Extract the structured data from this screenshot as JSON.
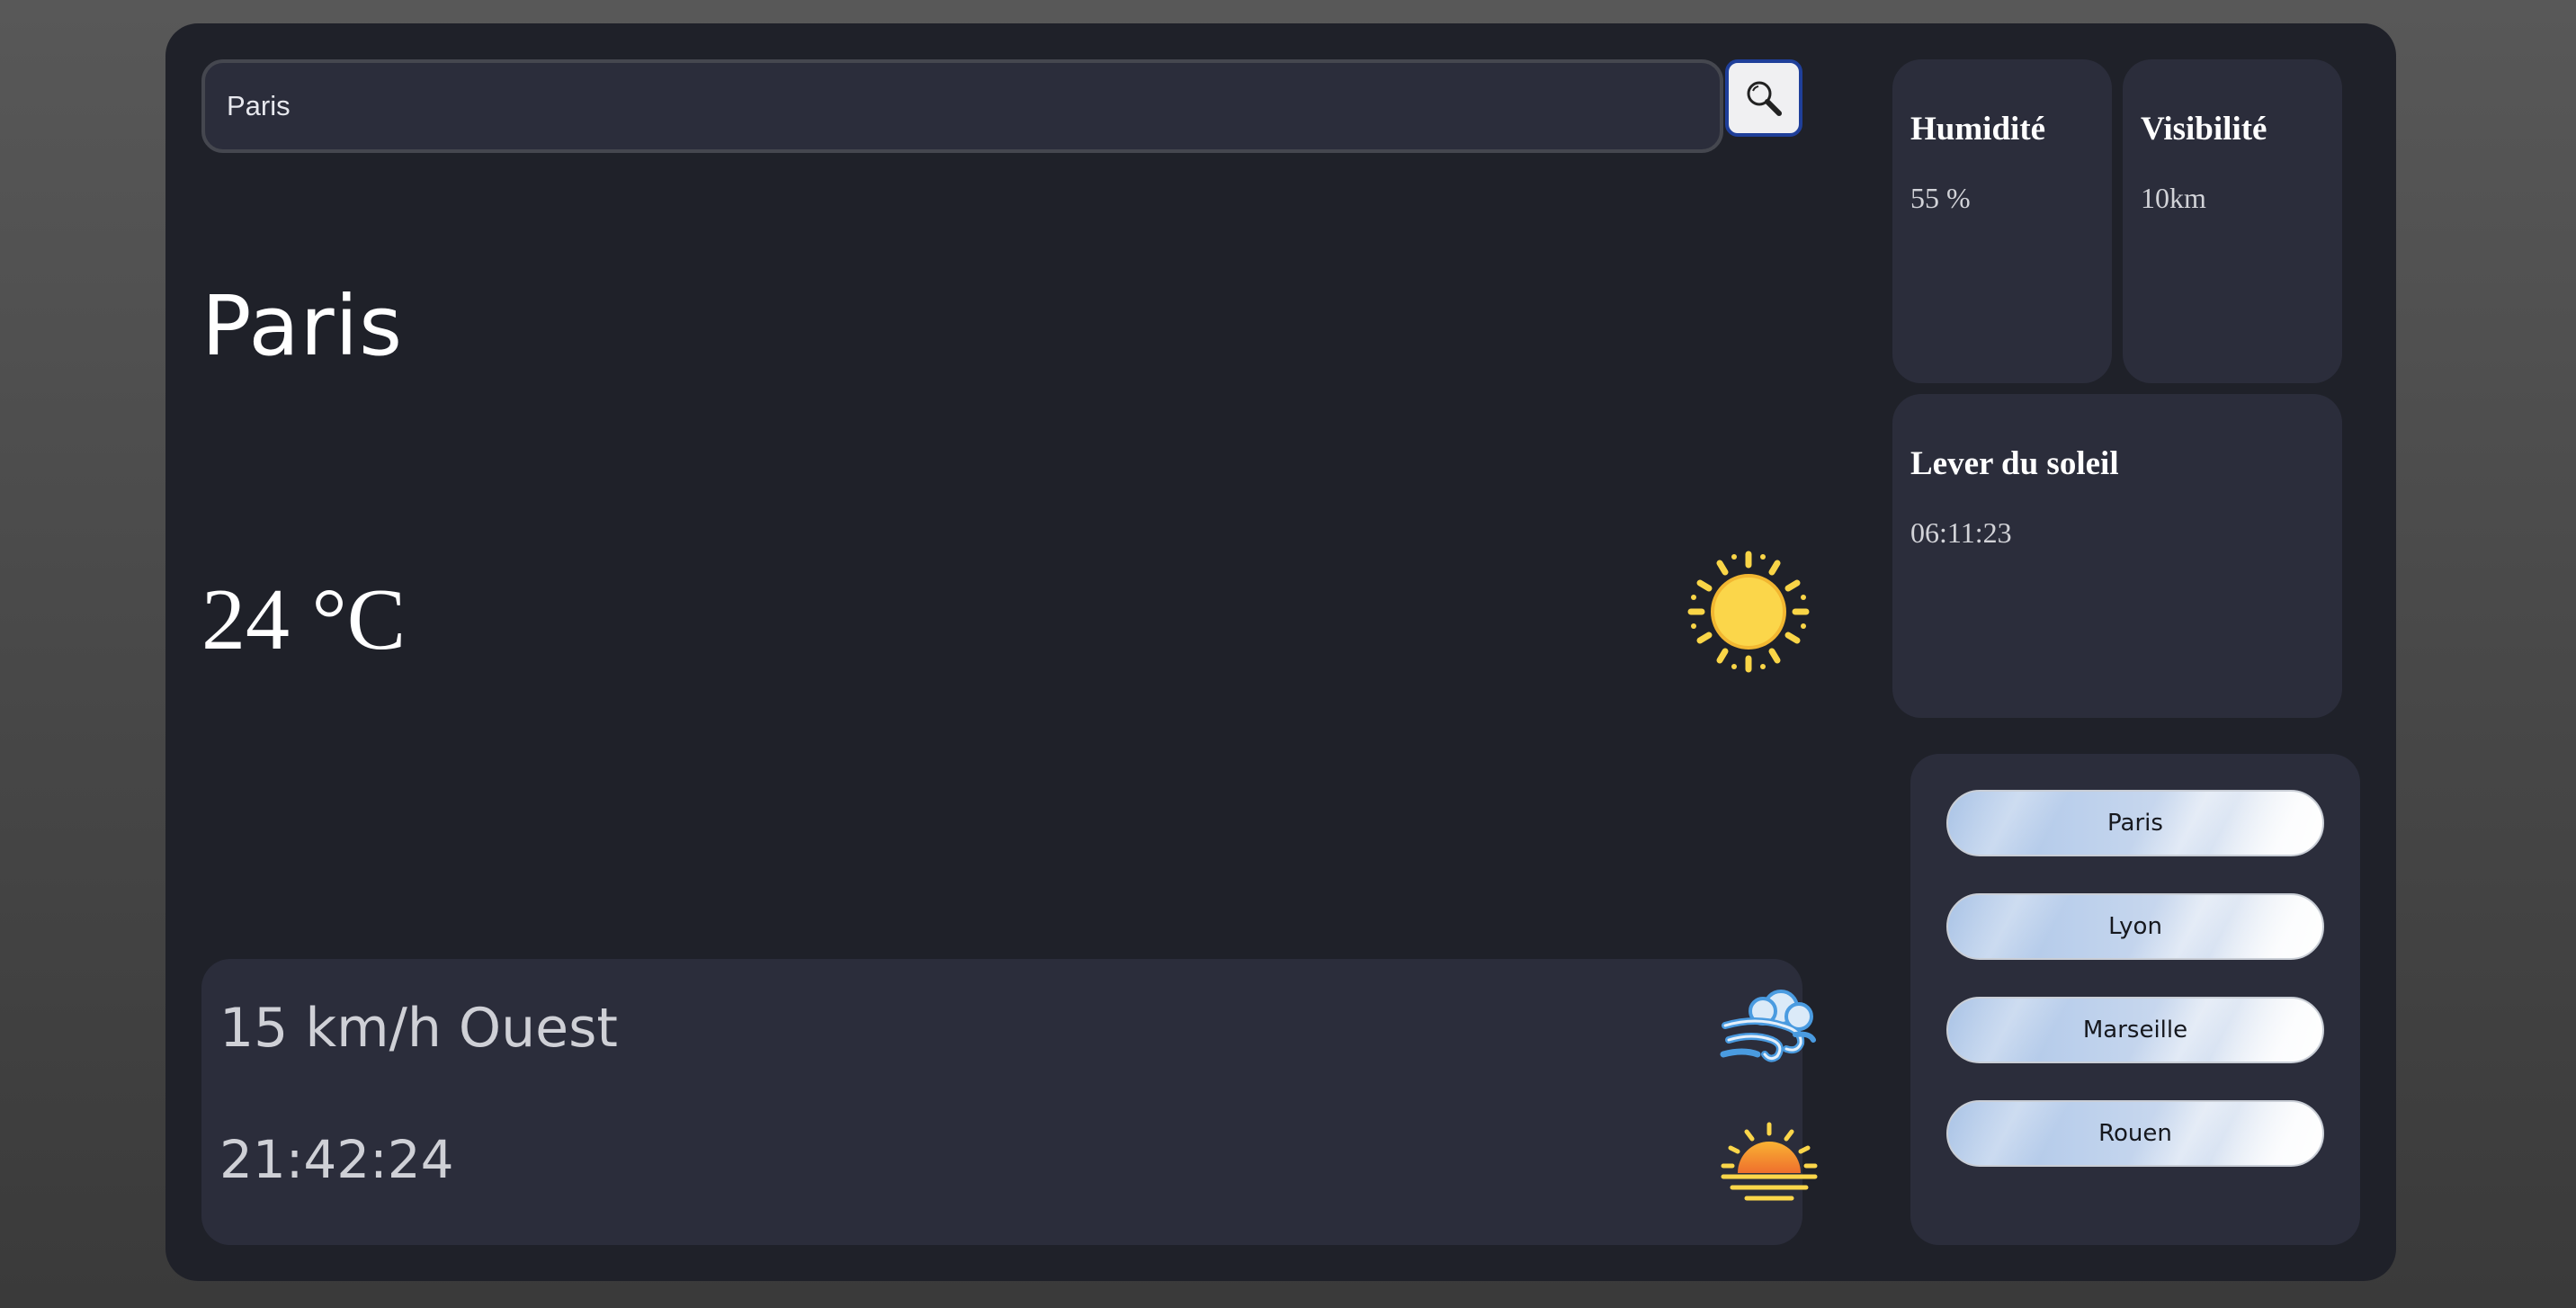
{
  "search": {
    "value": "Paris",
    "button_icon": "magnifier-icon"
  },
  "current": {
    "city": "Paris",
    "temperature": "24 °C",
    "condition_icon": "sun-icon"
  },
  "details": {
    "wind": "15 km/h Ouest",
    "wind_icon": "wind-icon",
    "time": "21:42:24",
    "time_icon": "sunset-icon"
  },
  "cards": {
    "humidity": {
      "title": "Humidité",
      "value": "55 %"
    },
    "visibility": {
      "title": "Visibilité",
      "value": "10km"
    },
    "sunrise": {
      "title": "Lever du soleil",
      "value": "06:11:23"
    }
  },
  "cities": [
    {
      "label": "Paris"
    },
    {
      "label": "Lyon"
    },
    {
      "label": "Marseille"
    },
    {
      "label": "Rouen"
    }
  ],
  "colors": {
    "background": "#4d4d4d",
    "panel": "#1f2129",
    "card": "#2b2d3b",
    "accent_border": "#1f3f9a",
    "sun": "#f9d547"
  }
}
